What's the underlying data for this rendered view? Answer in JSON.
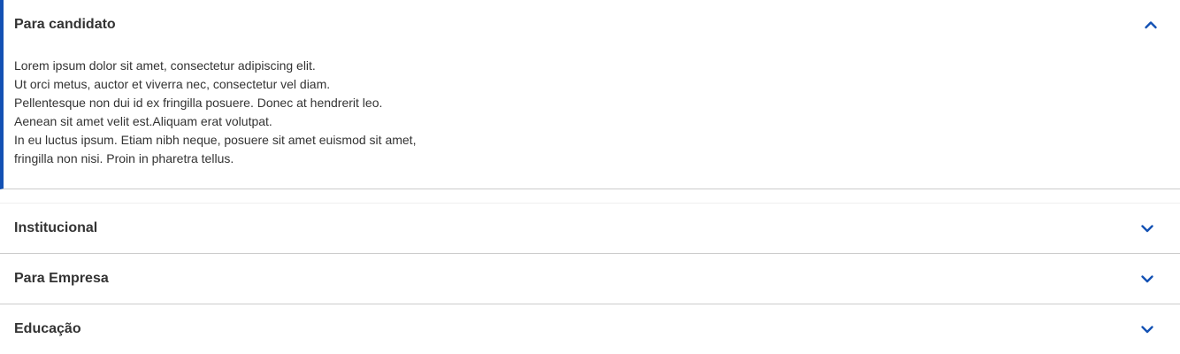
{
  "accordion": {
    "accent_color": "#1351b4",
    "open_item": {
      "title": "Para candidato",
      "icon": "chevron-up-icon",
      "body_lines": [
        "Lorem ipsum dolor sit amet, consectetur adipiscing elit.",
        "Ut orci metus, auctor et viverra nec, consectetur vel diam.",
        "Pellentesque non dui id ex fringilla posuere. Donec at hendrerit leo.",
        "Aenean sit amet velit est.Aliquam erat volutpat.",
        "In eu luctus ipsum. Etiam nibh neque, posuere sit amet euismod sit amet,",
        "fringilla non nisi. Proin in pharetra tellus."
      ]
    },
    "closed_items": [
      {
        "title": "Institucional",
        "icon": "chevron-down-icon"
      },
      {
        "title": "Para Empresa",
        "icon": "chevron-down-icon"
      },
      {
        "title": "Educação",
        "icon": "chevron-down-icon"
      }
    ]
  }
}
